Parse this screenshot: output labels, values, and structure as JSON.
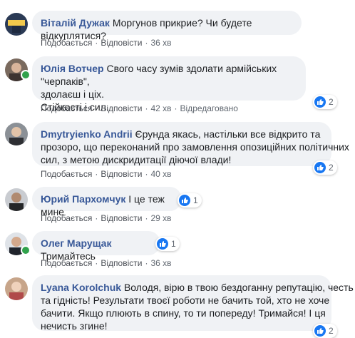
{
  "actions": {
    "like": "Подобається",
    "reply": "Відповісти",
    "separator": "·",
    "edited": "Відредаговано"
  },
  "comments": [
    {
      "author": "Віталій Дужак",
      "text": "Моргунов прикрие? Чи будете відкуплятися?",
      "time": "36 хв"
    },
    {
      "author": "Юлія Вотчер",
      "text_lines": [
        "Свого часу зумів здолати армійських \"черпаків\",",
        "здолаєш і ціх.",
        "Стійкості і сил."
      ],
      "time": "42 хв",
      "reactions": "2"
    },
    {
      "author": "Dmytryienko Andrii",
      "text_lines": [
        "Єрунда якась, настільки все відкрито та",
        "прозоро, що переконаний про замовлення опозиційних політичних",
        "сил, з метою дискридитації діючої влади!"
      ],
      "time": "40 хв",
      "reactions": "2"
    },
    {
      "author": "Юрий Пархомчук",
      "text": "І це теж мине",
      "time": "29 хв",
      "reactions": "1"
    },
    {
      "author": "Олег Марущак",
      "text": "Тримайтесь",
      "time": "36 хв",
      "reactions": "1"
    },
    {
      "author": "Lyana Korolchuk",
      "text_lines": [
        "Володя, вірю в твою бездоганну репутацію, честь",
        "та гідність! Результати твоєї роботи не бачить той, хто не хоче",
        "бачити. Якщо плюють в спину, то ти попереду! Тримайся! І ця",
        "нечисть згине!"
      ],
      "reactions": "2"
    }
  ],
  "colors": {
    "author": "#385898",
    "bubble": "#f0f2f5",
    "like_blue": "#1877f2",
    "online": "#31a24c"
  }
}
